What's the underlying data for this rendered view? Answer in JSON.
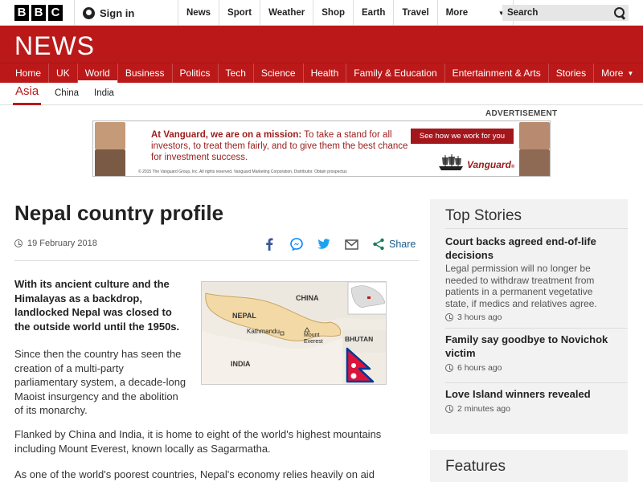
{
  "topbar": {
    "logo_letters": [
      "B",
      "B",
      "C"
    ],
    "signin": "Sign in",
    "nav": [
      "News",
      "Sport",
      "Weather",
      "Shop",
      "Earth",
      "Travel"
    ],
    "more": "More",
    "search_placeholder": "Search"
  },
  "news_logo": "NEWS",
  "main_nav": [
    "Home",
    "UK",
    "World",
    "Business",
    "Politics",
    "Tech",
    "Science",
    "Health",
    "Family & Education",
    "Entertainment & Arts",
    "Stories",
    "More"
  ],
  "main_nav_active": "World",
  "sub_nav": {
    "section": "Asia",
    "items": [
      "China",
      "India"
    ]
  },
  "advertisement": {
    "label": "ADVERTISEMENT",
    "headline": "At Vanguard, we are on a mission:",
    "body": " To take a stand for all investors, to treat them fairly, and to give them the best chance for investment success.",
    "cta": "See how we work for you",
    "brand": "Vanguard",
    "fine_print": "© 2015 The Vanguard Group, Inc. All rights reserved. Vanguard Marketing Corporation, Distributor. Obtain prospectus"
  },
  "article": {
    "title": "Nepal country profile",
    "date": "19 February 2018",
    "share_label": "Share",
    "intro": "With its ancient culture and the Himalayas as a backdrop, landlocked Nepal was closed to the outside world until the 1950s.",
    "p1": "Since then the country has seen the creation of a multi-party parliamentary system, a decade-long Maoist insurgency and the abolition of its monarchy.",
    "p2": "Flanked by China and India, it is home to eight of the world's highest mountains including Mount Everest, known locally as Sagarmatha.",
    "p3": "As one of the world's poorest countries, Nepal's economy relies heavily on aid and",
    "map_labels": {
      "china": "CHINA",
      "nepal": "NEPAL",
      "kathmandu": "Kathmandu",
      "everest": "Mount Everest",
      "india": "INDIA",
      "bhutan": "BHUTAN"
    }
  },
  "sidebar": {
    "top_stories_title": "Top Stories",
    "stories": [
      {
        "headline": "Court backs agreed end-of-life decisions",
        "summary": "Legal permission will no longer be needed to withdraw treatment from patients in a permanent vegetative state, if medics and relatives agree.",
        "time": "3 hours ago"
      },
      {
        "headline": "Family say goodbye to Novichok victim",
        "summary": "",
        "time": "6 hours ago"
      },
      {
        "headline": "Love Island winners revealed",
        "summary": "",
        "time": "2 minutes ago"
      }
    ],
    "features_title": "Features"
  },
  "colors": {
    "bbc_red": "#bb1919",
    "link_blue": "#1a5a8a",
    "facebook": "#3b5998",
    "messenger": "#0084ff",
    "twitter": "#1da1f2",
    "email": "#555555",
    "share": "#1a7a5a"
  }
}
